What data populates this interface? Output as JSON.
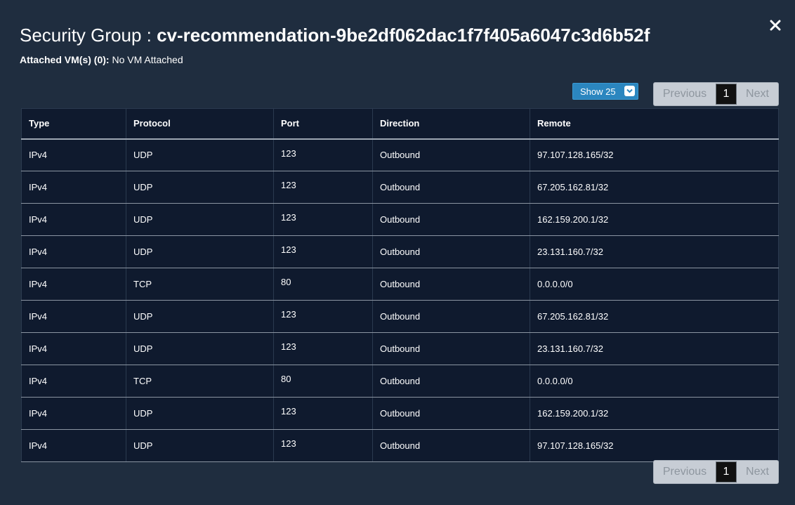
{
  "header": {
    "title_prefix": "Security Group : ",
    "title_name": "cv-recommendation-9be2df062dac1f7f405a6047c3d6b52f",
    "attached_label": "Attached VM(s) (0):",
    "attached_value": " No VM Attached"
  },
  "close_icon": "close-icon",
  "page_size_select": {
    "value": "Show 25"
  },
  "pagination": {
    "previous": "Previous",
    "current_page": "1",
    "next": "Next"
  },
  "table": {
    "columns": [
      "Type",
      "Protocol",
      "Port",
      "Direction",
      "Remote"
    ],
    "rows": [
      [
        "IPv4",
        "UDP",
        "123",
        "Outbound",
        "97.107.128.165/32"
      ],
      [
        "IPv4",
        "UDP",
        "123",
        "Outbound",
        "67.205.162.81/32"
      ],
      [
        "IPv4",
        "UDP",
        "123",
        "Outbound",
        "162.159.200.1/32"
      ],
      [
        "IPv4",
        "UDP",
        "123",
        "Outbound",
        "23.131.160.7/32"
      ],
      [
        "IPv4",
        "TCP",
        "80",
        "Outbound",
        "0.0.0.0/0"
      ],
      [
        "IPv4",
        "UDP",
        "123",
        "Outbound",
        "67.205.162.81/32"
      ],
      [
        "IPv4",
        "UDP",
        "123",
        "Outbound",
        "23.131.160.7/32"
      ],
      [
        "IPv4",
        "TCP",
        "80",
        "Outbound",
        "0.0.0.0/0"
      ],
      [
        "IPv4",
        "UDP",
        "123",
        "Outbound",
        "162.159.200.1/32"
      ],
      [
        "IPv4",
        "UDP",
        "123",
        "Outbound",
        "97.107.128.165/32"
      ]
    ]
  },
  "colors": {
    "background": "#1f2d3f",
    "table_background": "#0f1a2e",
    "select_accent": "#2b86bf",
    "pager_background": "#c7cdd5"
  }
}
